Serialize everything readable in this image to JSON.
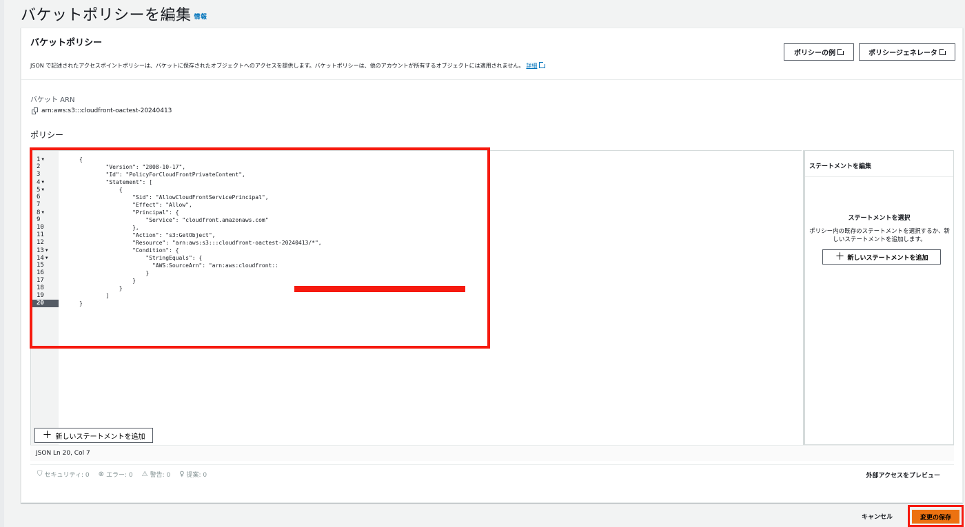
{
  "page": {
    "title": "バケットポリシーを編集",
    "info_link": "情報"
  },
  "panel": {
    "title": "バケットポリシー",
    "description": "JSON で記述されたアクセスポイントポリシーは、バケットに保存されたオブジェクトへのアクセスを提供します。バケットポリシーは、他のアカウントが所有するオブジェクトには適用されません。",
    "details_link": "詳細",
    "example_button": "ポリシーの例",
    "generator_button": "ポリシージェネレータ"
  },
  "bucket_arn": {
    "label": "バケット ARN",
    "value": "arn:aws:s3:::cloudfront-oactest-20240413"
  },
  "policy": {
    "label": "ポリシー",
    "line_numbers": [
      "1",
      "2",
      "3",
      "4",
      "5",
      "6",
      "7",
      "8",
      "9",
      "10",
      "11",
      "12",
      "13",
      "14",
      "15",
      "16",
      "17",
      "18",
      "19",
      "20"
    ],
    "code_lines": [
      "{",
      "        \"Version\": \"2008-10-17\",",
      "        \"Id\": \"PolicyForCloudFrontPrivateContent\",",
      "        \"Statement\": [",
      "            {",
      "                \"Sid\": \"AllowCloudFrontServicePrincipal\",",
      "                \"Effect\": \"Allow\",",
      "                \"Principal\": {",
      "                    \"Service\": \"cloudfront.amazonaws.com\"",
      "                },",
      "                \"Action\": \"s3:GetObject\",",
      "                \"Resource\": \"arn:aws:s3:::cloudfront-oactest-20240413/*\",",
      "                \"Condition\": {",
      "                    \"StringEquals\": {",
      "                      \"AWS:SourceArn\": \"arn:aws:cloudfront::",
      "                    }",
      "                }",
      "            }",
      "        ]",
      "}"
    ],
    "add_statement_button": "新しいステートメントを追加",
    "status": "JSON  Ln 20, Col 7"
  },
  "validation": {
    "security": "セキュリティ: 0",
    "errors": "エラー: 0",
    "warnings": "警告: 0",
    "suggestions": "提案: 0",
    "preview_link": "外部アクセスをプレビュー"
  },
  "side_panel": {
    "title": "ステートメントを編集",
    "empty_title": "ステートメントを選択",
    "empty_desc": "ポリシー内の既存のステートメントを選択するか、新しいステートメントを追加します。",
    "add_button": "新しいステートメントを追加"
  },
  "footer": {
    "cancel": "キャンセル",
    "save": "変更の保存"
  },
  "colors": {
    "highlight": "#f61a0f",
    "primary_button": "#ec7211",
    "link": "#0073bb"
  }
}
